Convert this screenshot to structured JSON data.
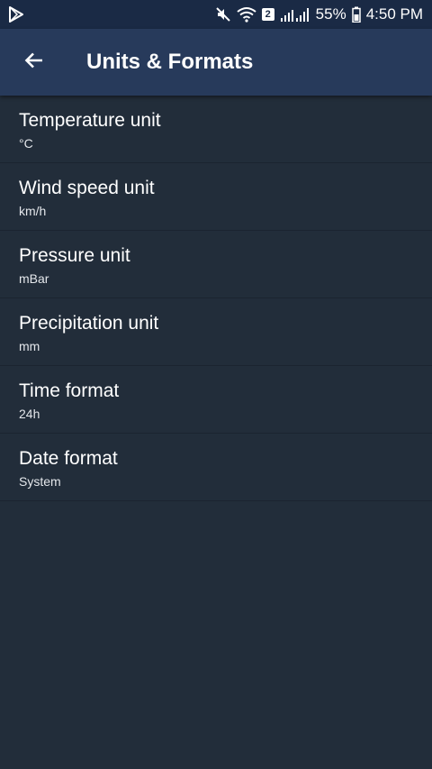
{
  "status_bar": {
    "battery_percent": "55%",
    "time": "4:50 PM",
    "sim_slot": "2",
    "icons": [
      "play-store-icon",
      "mute-icon",
      "wifi-icon",
      "sim-badge",
      "signal-icon",
      "battery-icon"
    ]
  },
  "app_bar": {
    "title": "Units & Formats",
    "back_icon": "back-arrow-icon"
  },
  "settings": {
    "items": [
      {
        "label": "Temperature unit",
        "value": "°C"
      },
      {
        "label": "Wind speed unit",
        "value": "km/h"
      },
      {
        "label": "Pressure unit",
        "value": "mBar"
      },
      {
        "label": "Precipitation unit",
        "value": "mm"
      },
      {
        "label": "Time format",
        "value": "24h"
      },
      {
        "label": "Date format",
        "value": "System"
      }
    ]
  },
  "colors": {
    "status_bar": "#1a2a45",
    "app_bar": "#273a5b",
    "background": "#222d3a",
    "divider": "#1b2430",
    "text_primary": "#ffffff"
  }
}
